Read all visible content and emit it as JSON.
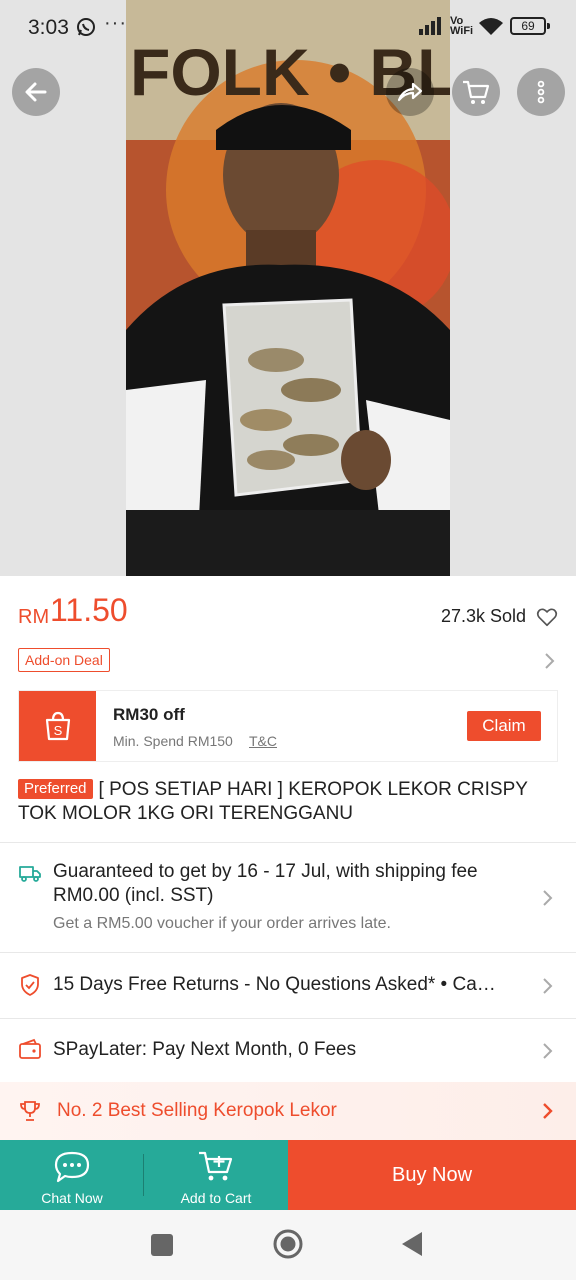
{
  "status_bar": {
    "time": "3:03",
    "dots": "···",
    "network": "Vo WiFi",
    "battery": "69"
  },
  "hero": {
    "photo_text": "FOLK • BLUES"
  },
  "product": {
    "currency": "RM",
    "price": "11.50",
    "sold": "27.3k Sold",
    "addon_label": "Add-on Deal",
    "preferred_badge": "Preferred",
    "title": "[ POS SETIAP HARI ] KEROPOK LEKOR CRISPY TOK MOLOR 1KG ORI TERENGGANU"
  },
  "voucher": {
    "title": "RM30 off",
    "min_spend": "Min. Spend RM150",
    "tc": "T&C",
    "claim": "Claim"
  },
  "shipping": {
    "text": "Guaranteed to get by 16 - 17 Jul, with shipping fee RM0.00 (incl. SST)",
    "sub": "Get a RM5.00 voucher if your order arrives late."
  },
  "returns": {
    "text": "15 Days Free Returns - No Questions Asked*  •  Ca…"
  },
  "paylater": {
    "text": "SPayLater: Pay Next Month, 0 Fees"
  },
  "best_selling": {
    "text": "No. 2 Best Selling Keropok Lekor"
  },
  "bottom_bar": {
    "chat_label": "Chat Now",
    "cart_label": "Add to Cart",
    "buy_label": "Buy Now"
  },
  "colors": {
    "brand": "#ee4d2d",
    "teal": "#26aa99"
  }
}
